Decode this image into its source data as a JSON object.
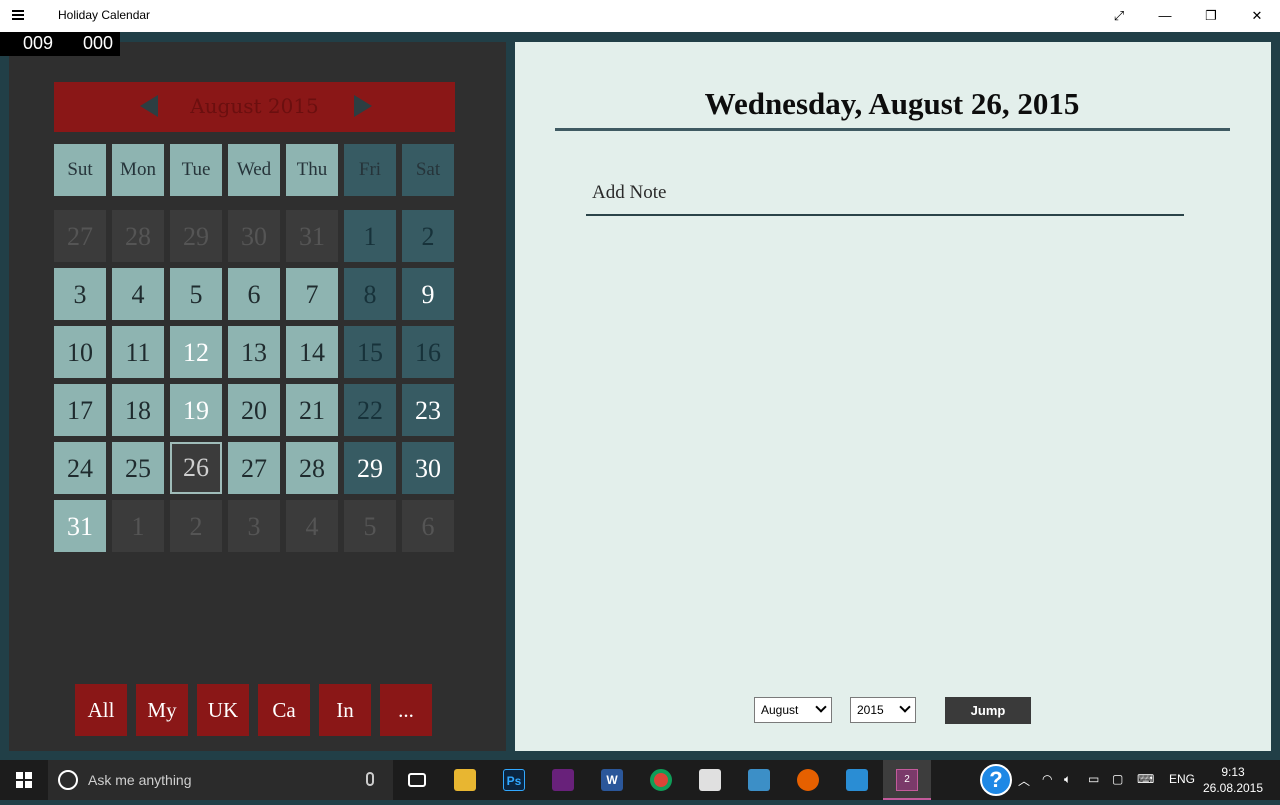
{
  "window": {
    "title": "Holiday Calendar",
    "controls": {
      "fullscreen": "⤢",
      "minimize": "—",
      "restore": "❐",
      "close": "✕"
    }
  },
  "counter": {
    "left": "009",
    "right": "000"
  },
  "calendar": {
    "month_label": "August 2015",
    "weekdays": [
      "Sut",
      "Mon",
      "Tue",
      "Wed",
      "Thu",
      "Fri",
      "Sat"
    ],
    "weeks": [
      [
        "27",
        "28",
        "29",
        "30",
        "31",
        "1",
        "2"
      ],
      [
        "3",
        "4",
        "5",
        "6",
        "7",
        "8",
        "9"
      ],
      [
        "10",
        "11",
        "12",
        "13",
        "14",
        "15",
        "16"
      ],
      [
        "17",
        "18",
        "19",
        "20",
        "21",
        "22",
        "23"
      ],
      [
        "24",
        "25",
        "26",
        "27",
        "28",
        "29",
        "30"
      ],
      [
        "31",
        "1",
        "2",
        "3",
        "4",
        "5",
        "6"
      ]
    ],
    "selected_date": "26",
    "filters": [
      "All",
      "My",
      "UK",
      "Ca",
      "In",
      "..."
    ]
  },
  "detail": {
    "heading": "Wednesday, August 26, 2015",
    "note_placeholder": "Add Note",
    "month_select": "August",
    "year_select": "2015",
    "jump_label": "Jump"
  },
  "taskbar": {
    "search_placeholder": "Ask me anything",
    "language": "ENG",
    "time": "9:13",
    "date": "26.08.2015",
    "active_app_badge": "2"
  },
  "colors": {
    "accent_red": "#8a1717",
    "weekday_cell": "#8eb4b1",
    "weekend_cell": "#375b63",
    "panel_dark": "#2f2f2f",
    "detail_bg": "#e3efeb",
    "frame": "#213f47"
  }
}
